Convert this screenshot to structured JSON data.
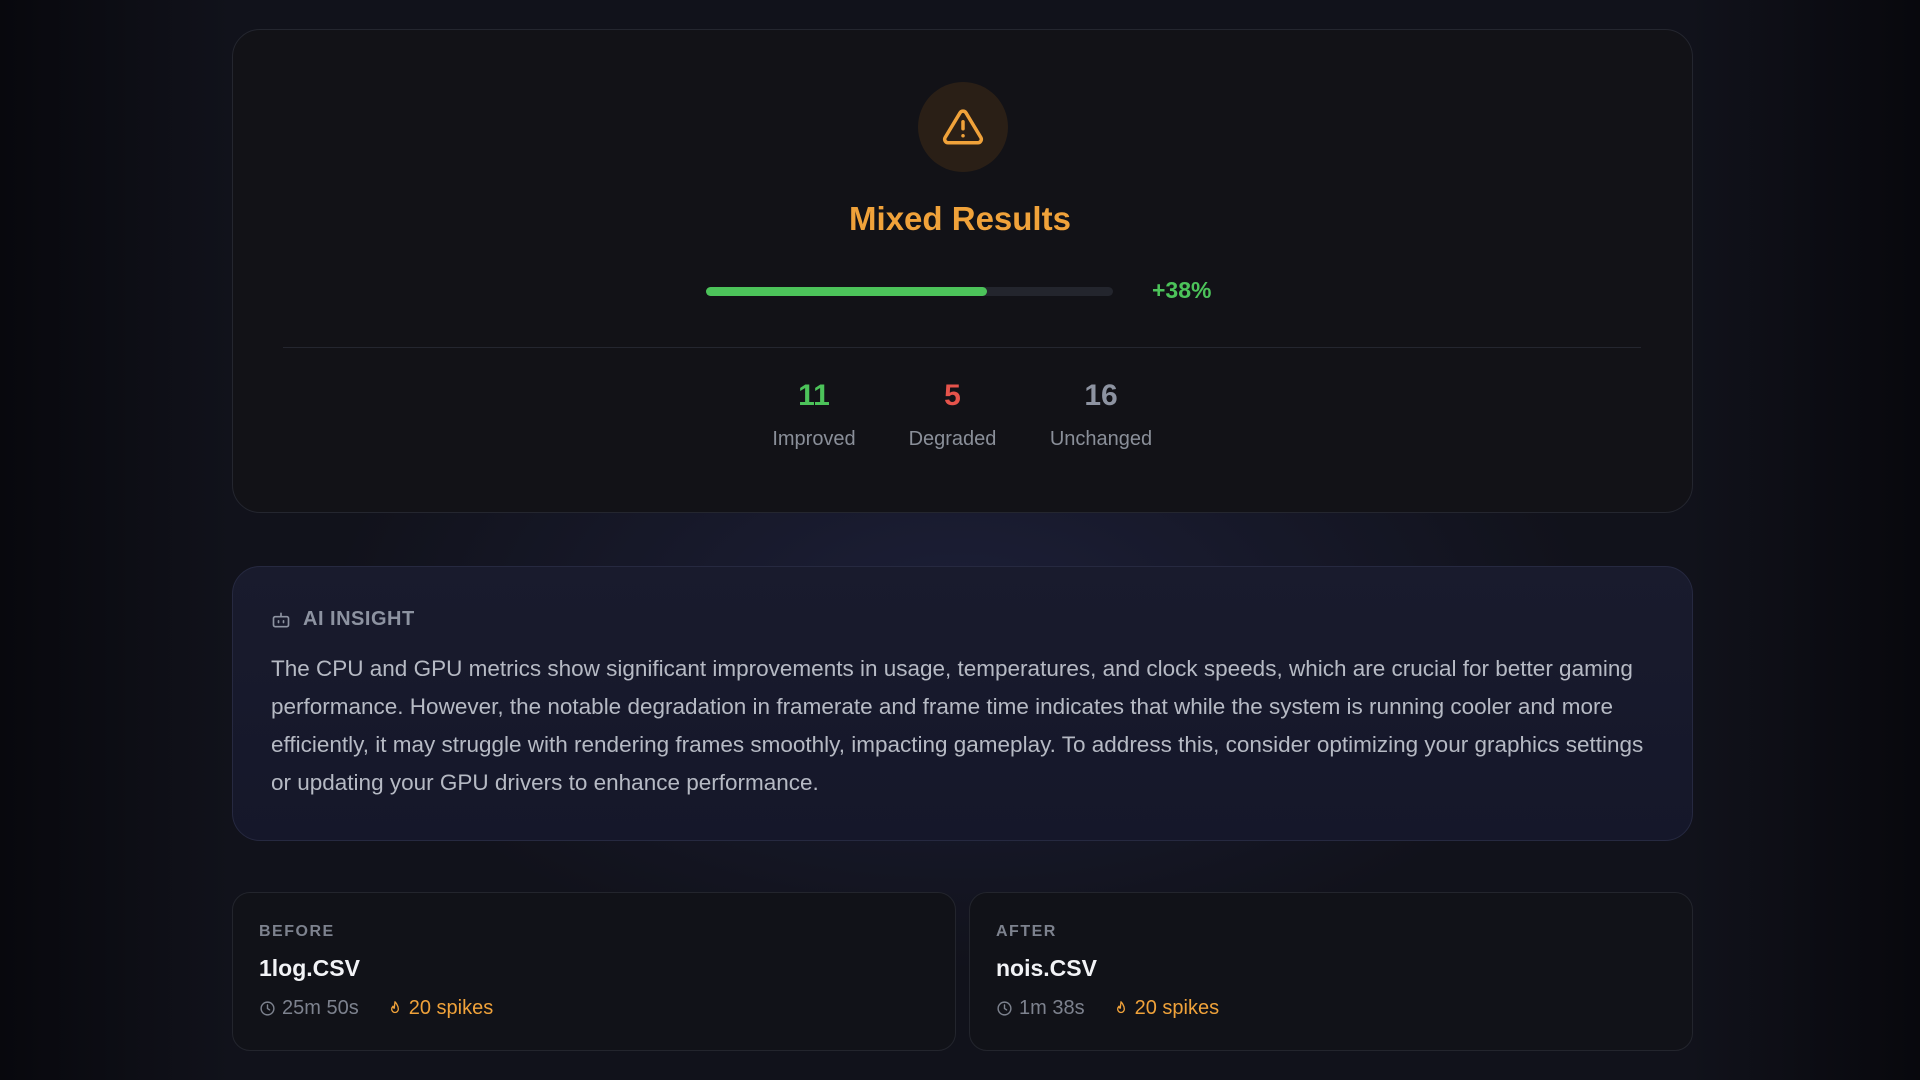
{
  "summary": {
    "title": "Mixed Results",
    "score_percent_label": "+38%",
    "score_fraction": 0.69,
    "stats": [
      {
        "value": "11",
        "label": "Improved",
        "color": "#4cc35a"
      },
      {
        "value": "5",
        "label": "Degraded",
        "color": "#e5534b"
      },
      {
        "value": "16",
        "label": "Unchanged",
        "color": "#8d93a1"
      }
    ],
    "icon": "warning-triangle-icon"
  },
  "insight": {
    "heading": "AI INSIGHT",
    "icon": "robot-icon",
    "text": "The CPU and GPU metrics show significant improvements in usage, temperatures, and clock speeds, which are crucial for better gaming performance. However, the notable degradation in framerate and frame time indicates that while the system is running cooler and more efficiently, it may struggle with rendering frames smoothly, impacting gameplay. To address this, consider optimizing your graphics settings or updating your GPU drivers to enhance performance."
  },
  "before": {
    "tag": "BEFORE",
    "filename": "1log.CSV",
    "duration": "25m 50s",
    "spikes": "20 spikes"
  },
  "after": {
    "tag": "AFTER",
    "filename": "nois.CSV",
    "duration": "1m 38s",
    "spikes": "20 spikes"
  },
  "colors": {
    "accent_warning": "#f0a23a",
    "positive": "#4cc35a",
    "negative": "#e5534b",
    "neutral": "#8d93a1"
  }
}
